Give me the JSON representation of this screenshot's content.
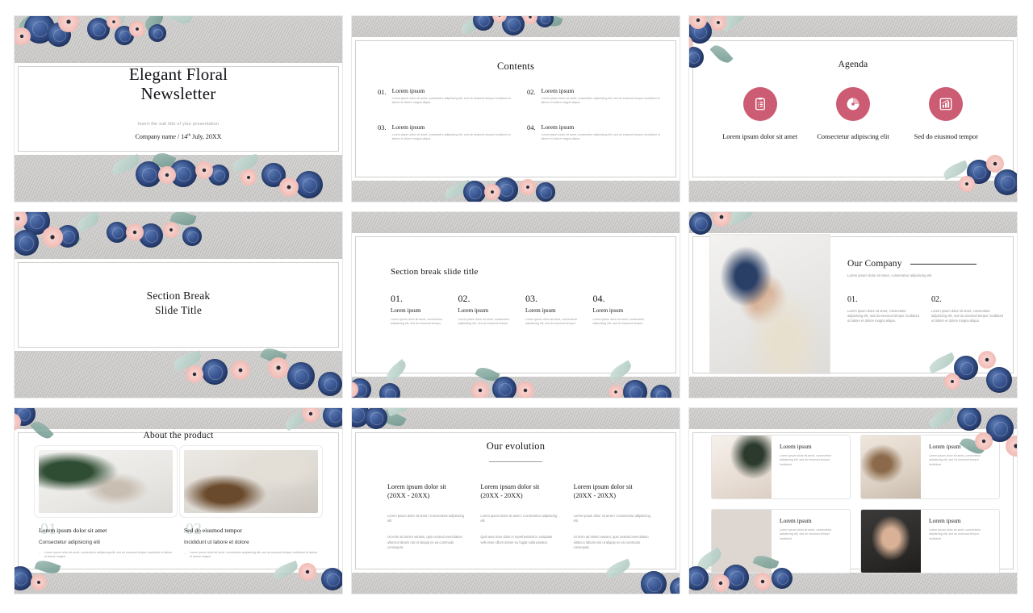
{
  "theme": {
    "accent_rose": "#cc5c73",
    "band_gray": "#c9c8c6",
    "ink": "#15171b",
    "muted": "#8f9195"
  },
  "slides": [
    {
      "id": "title-slide",
      "title_line1": "Elegant Floral",
      "title_line2": "Newsletter",
      "subtitle": "Insert the sub title of your presentation",
      "company": "Company name  /  14",
      "company_sup": "th",
      "company_rest": " July, 20XX"
    },
    {
      "id": "contents-slide",
      "heading": "Contents",
      "items": [
        {
          "num": "01.",
          "title": "Lorem ipsum",
          "body": "Lorem ipsum dolor sit amet, consectetur adipisicing elit, sed do eiusmod tempor incididunt ut labore et dolore magna aliqua."
        },
        {
          "num": "02.",
          "title": "Lorem ipsum",
          "body": "Lorem ipsum dolor sit amet, consectetur adipisicing elit, sed do eiusmod tempor incididunt ut labore et dolore magna aliqua."
        },
        {
          "num": "03.",
          "title": "Lorem ipsum",
          "body": "Lorem ipsum dolor sit amet, consectetur adipisicing elit, sed do eiusmod tempor incididunt ut labore et dolore magna aliqua."
        },
        {
          "num": "04.",
          "title": "Lorem ipsum",
          "body": "Lorem ipsum dolor sit amet, consectetur adipisicing elit, sed do eiusmod tempor incididunt ut labore et dolore magna aliqua."
        }
      ]
    },
    {
      "id": "agenda-slide",
      "heading": "Agenda",
      "items": [
        {
          "icon": "clipboard-list-icon",
          "caption": "Lorem ipsum dolor sit amet"
        },
        {
          "icon": "pie-chart-icon",
          "caption": "Consectetur adipiscing elit"
        },
        {
          "icon": "bar-chart-icon",
          "caption": "Sed do eiusmod tempor"
        }
      ]
    },
    {
      "id": "section-break-slide",
      "title_line1": "Section Break",
      "title_line2": "Slide Title"
    },
    {
      "id": "section-break-detail-slide",
      "heading": "Section break slide title",
      "items": [
        {
          "num": "01.",
          "subhead": "Lorem ipsum",
          "body": "Lorem ipsum dolor sit amet, consectetur adipisicing elit, sed do eiusmod tempor"
        },
        {
          "num": "02.",
          "subhead": "Lorem ipsum",
          "body": "Lorem ipsum dolor sit amet, consectetur adipisicing elit, sed do eiusmod tempor"
        },
        {
          "num": "03.",
          "subhead": "Lorem ipsum",
          "body": "Lorem ipsum dolor sit amet, consectetur adipisicing elit, sed do eiusmod tempor"
        },
        {
          "num": "04.",
          "subhead": "Lorem ipsum",
          "body": "Lorem ipsum dolor sit amet, consectetur adipisicing elit, sed do eiusmod tempor"
        }
      ]
    },
    {
      "id": "our-company-slide",
      "heading": "Our Company",
      "subtitle": "Lorem ipsum dolor sit amet, consectetur adipisicing elit",
      "photo_alt": "bride-holding-bouquet-photo",
      "items": [
        {
          "num": "01.",
          "body": "Lorem ipsum dolor sit amet, consectetur adipisicing elit, sed do eiusmod tempor incididunt ut labore et dolore magna aliqua."
        },
        {
          "num": "02.",
          "body": "Lorem ipsum dolor sit amet, consectetur adipisicing elit, sed do eiusmod tempor incididunt ut labore et dolore magna aliqua."
        }
      ]
    },
    {
      "id": "about-the-product-slide",
      "heading": "About the product",
      "items": [
        {
          "bignum": "01",
          "title": "Lorem ipsum dolor sit amet",
          "subtitle": "Consectetur adipisicing elit",
          "bullet": "Lorem ipsum dolor sit amet, consectetur adipisicing elit, sed do eiusmod tempor incididunt ut labore et dolore magna",
          "photo_alt": "table-setting-photo"
        },
        {
          "bignum": "02",
          "title": "Sed do eiusmod tempor",
          "subtitle": "Incididunt ut labore et dolore",
          "bullet": "Lorem ipsum dolor sit amet, consectetur adipisicing elit, sed do eiusmod tempor incididunt ut labore et dolore magna",
          "photo_alt": "banquet-table-photo"
        }
      ]
    },
    {
      "id": "our-evolution-slide",
      "heading": "Our evolution",
      "columns": [
        {
          "head": "Lorem ipsum dolor sit (20XX - 20XX)",
          "p1": "Lorem ipsum dolor sit amet./ Consectetur adipisicing elit",
          "p2": "Ut enim ad minim veniam, quis nostrud exercitation ullamco laboris nisi ut aliquip ex ea commodo consequat."
        },
        {
          "head": "Lorem ipsum dolor sit (20XX - 20XX)",
          "p1": "Lorem ipsum dolor sit amet./ Consectetur adipisicing elit",
          "p2": "Quis aute irure dolor in reprehenderit in voluptate velit esse cillum dolore eu fugiat nulla pariatur."
        },
        {
          "head": "Lorem ipsum dolor sit (20XX - 20XX)",
          "p1": "Lorem ipsum dolor sit amet./ Consectetur adipisicing elit",
          "p2": "Ut enim ad minim veniam, quis nostrud exercitation ullamco laboris nisi ut aliquip ex ea commodo consequat."
        }
      ]
    },
    {
      "id": "photo-grid-slide",
      "cards": [
        {
          "title": "Lorem ipsum",
          "body": "Lorem ipsum dolor sit amet, consectetur adipisicing elit, sed do eiusmod tempor incididunt",
          "photo_alt": "bride-and-groom-photo"
        },
        {
          "title": "Lorem ipsum",
          "body": "Lorem ipsum dolor sit amet, consectetur adipisicing elit, sed do eiusmod tempor incididunt",
          "photo_alt": "wedding-guests-photo"
        },
        {
          "title": "Lorem ipsum",
          "body": "Lorem ipsum dolor sit amet, consectetur adipisicing elit, sed do eiusmod tempor incididunt",
          "photo_alt": "wedding-cake-photo"
        },
        {
          "title": "Lorem ipsum",
          "body": "Lorem ipsum dolor sit amet, consectetur adipisicing elit, sed do eiusmod tempor incididunt",
          "photo_alt": "ring-exchange-photo"
        }
      ]
    }
  ]
}
